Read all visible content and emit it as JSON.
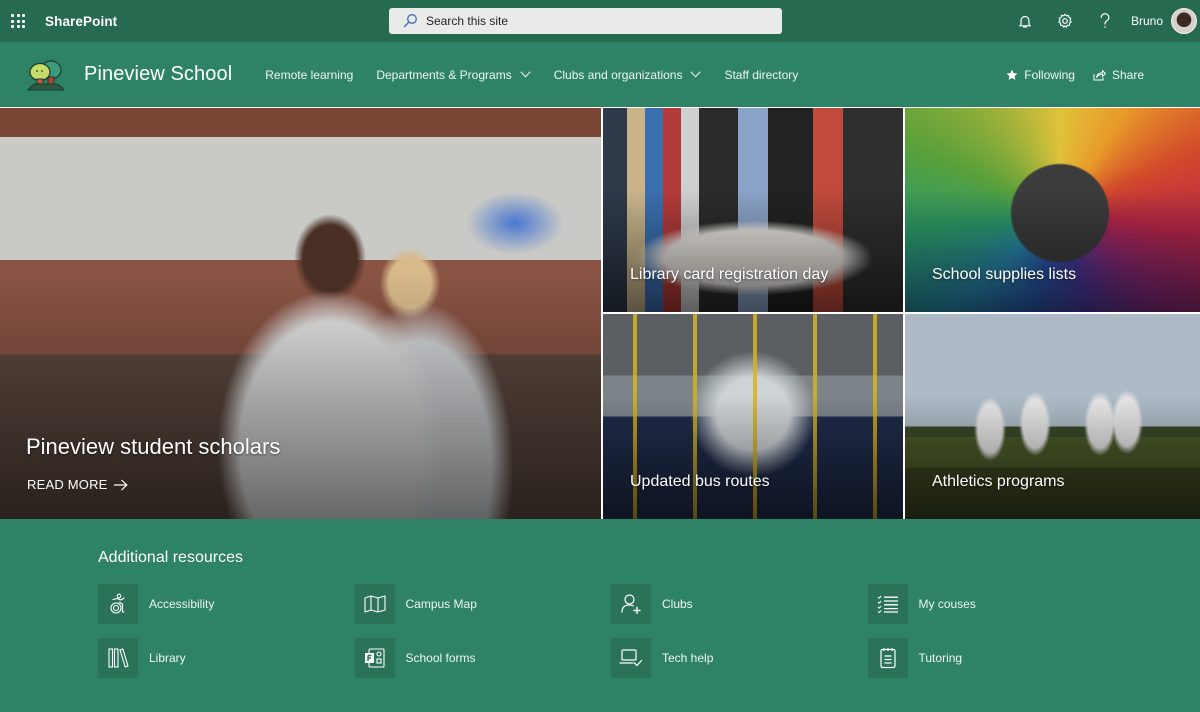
{
  "suitebar": {
    "app_name": "SharePoint",
    "search_placeholder": "Search this site",
    "user_name": "Bruno",
    "icons": [
      "app-launcher-icon",
      "search-icon",
      "bell-icon",
      "gear-icon",
      "help-icon"
    ]
  },
  "site": {
    "title": "Pineview School",
    "nav": [
      {
        "label": "Remote learning",
        "has_dropdown": false
      },
      {
        "label": "Departments & Programs",
        "has_dropdown": true
      },
      {
        "label": "Clubs and organizations",
        "has_dropdown": true
      },
      {
        "label": "Staff directory",
        "has_dropdown": false
      }
    ],
    "actions": {
      "following": "Following",
      "share": "Share"
    }
  },
  "hero": {
    "main": {
      "title": "Pineview student scholars",
      "read_more": "READ MORE"
    },
    "tiles": [
      {
        "title": "Library card registration day"
      },
      {
        "title": "School supplies lists"
      },
      {
        "title": "Updated bus routes"
      },
      {
        "title": "Athletics programs"
      }
    ]
  },
  "resources": {
    "title": "Additional resources",
    "items": [
      {
        "label": "Accessibility",
        "icon": "accessibility-icon"
      },
      {
        "label": "Campus Map",
        "icon": "map-icon"
      },
      {
        "label": "Clubs",
        "icon": "add-person-icon"
      },
      {
        "label": "My couses",
        "icon": "checklist-icon"
      },
      {
        "label": "Library",
        "icon": "library-books-icon"
      },
      {
        "label": "School forms",
        "icon": "forms-icon"
      },
      {
        "label": "Tech help",
        "icon": "laptop-check-icon"
      },
      {
        "label": "Tutoring",
        "icon": "notepad-icon"
      }
    ]
  },
  "colors": {
    "suitebar_bg": "#266a4f",
    "theme_green": "#2e8266",
    "icon_tile_bg": "#2a7359",
    "search_bg": "#e8ebe9"
  }
}
